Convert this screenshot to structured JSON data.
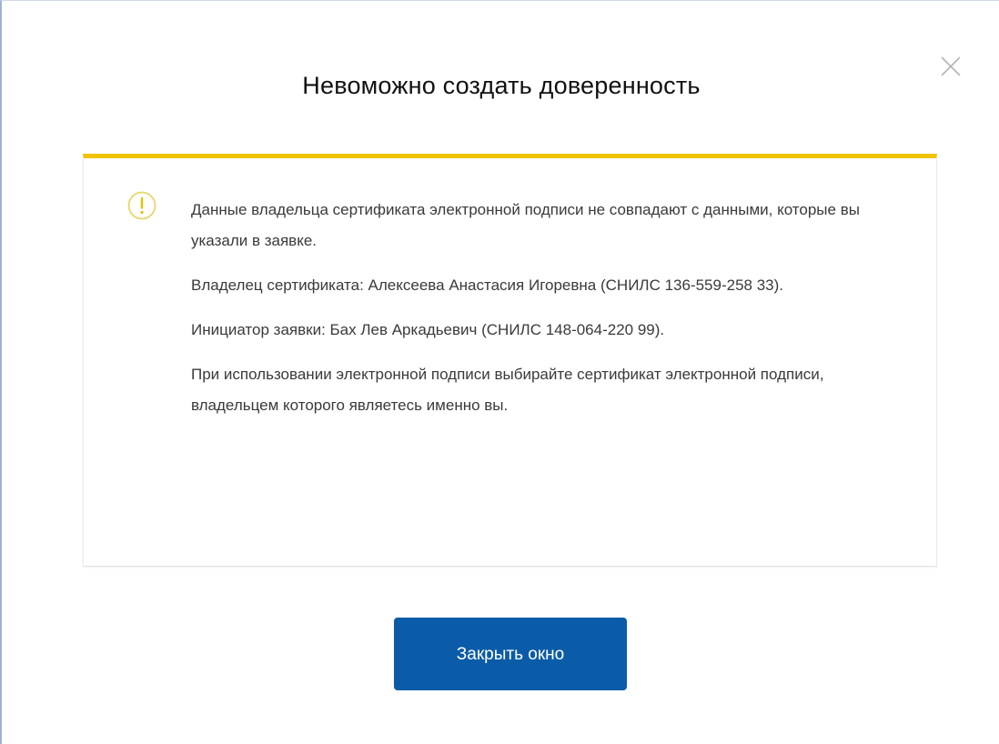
{
  "dialog": {
    "title": "Невоможно создать доверенность",
    "close_icon": "close-icon",
    "warning": {
      "icon": "exclamation-circle-icon",
      "accent_color": "#f0c400",
      "paragraphs": [
        "Данные владельца сертификата электронной подписи не совпадают с данными, которые вы указали в заявке.",
        "Владелец сертификата: Алексеева Анастасия Игоревна (СНИЛС 136-559-258 33).",
        "Инициатор заявки: Бах Лев Аркадьевич (СНИЛС 148-064-220 99).",
        "При использовании электронной подписи выбирайте сертификат электронной подписи, владельцем которого являетесь именно вы."
      ]
    },
    "close_window_button": {
      "label": "Закрыть окно",
      "color": "#0b5ca8"
    }
  }
}
